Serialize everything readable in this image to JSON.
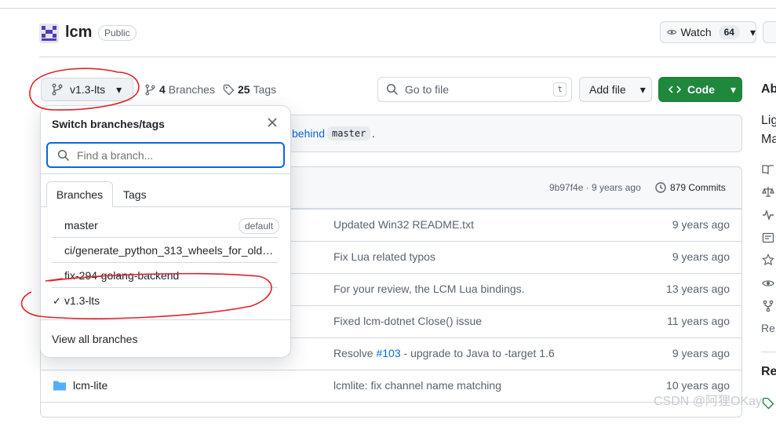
{
  "repo": {
    "name": "lcm",
    "visibility": "Public"
  },
  "watch": {
    "label": "Watch",
    "count": "64"
  },
  "branch_button": {
    "label": "v1.3-lts"
  },
  "branches_meta": {
    "count": "4",
    "label": "Branches"
  },
  "tags_meta": {
    "count": "25",
    "label": "Tags"
  },
  "goto": {
    "placeholder": "Go to file",
    "shortcut": "t"
  },
  "add_file": {
    "label": "Add file"
  },
  "code_btn": {
    "label": "Code"
  },
  "behind": {
    "text": "behind",
    "branch": "master",
    "trail": "."
  },
  "latest_commit": {
    "sha": "9b97f4e · 9 years ago",
    "commits": "879 Commits"
  },
  "files": [
    {
      "name": "",
      "message": "Updated Win32 README.txt",
      "age": "9 years ago"
    },
    {
      "name": "",
      "message": "Fix Lua related typos",
      "age": "9 years ago"
    },
    {
      "name": "",
      "message": "For your review, the LCM Lua bindings.",
      "age": "13 years ago"
    },
    {
      "name": "",
      "message": "Fixed lcm-dotnet Close() issue",
      "age": "11 years ago"
    },
    {
      "name": "",
      "message_pre": "Resolve ",
      "message_link": "#103",
      "message_post": " - upgrade to Java to -target 1.6",
      "age": "9 years ago"
    },
    {
      "name": "lcm-lite",
      "message": "lcmlite: fix channel name matching",
      "age": "10 years ago"
    }
  ],
  "sidebar": {
    "about": "Ab",
    "desc1": "Lig",
    "desc2": "Ma",
    "readme_partial": "Re",
    "releases": "Re"
  },
  "dropdown": {
    "title": "Switch branches/tags",
    "search_placeholder": "Find a branch...",
    "tabs": [
      "Branches",
      "Tags"
    ],
    "branches": [
      "master",
      "ci/generate_python_313_wheels_for_old…",
      "fix-294-golang-backend",
      "v1.3-lts"
    ],
    "default_label": "default",
    "view_all": "View all branches"
  },
  "watermark": "CSDN @阿狸OKay",
  "colors": {
    "accent": "#0969da",
    "code_green": "#1f883d",
    "annotation_red": "#e0202a"
  }
}
